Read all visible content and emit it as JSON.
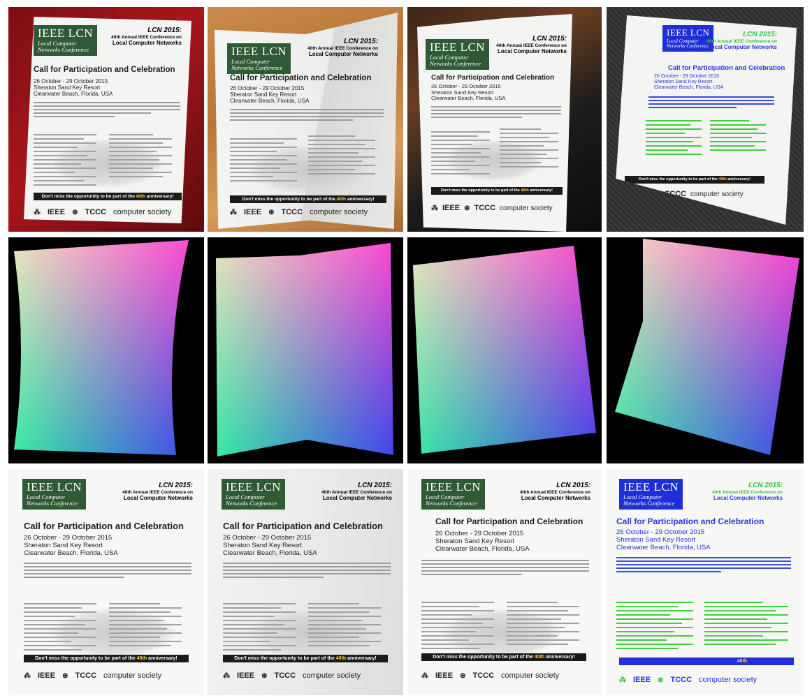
{
  "flyer": {
    "logo_main": "IEEE LCN",
    "logo_sub1": "Local Computer",
    "logo_sub2": "Networks Conference",
    "conf_title": "LCN 2015:",
    "conf_line2": "40th Annual IEEE Conference on",
    "conf_line3": "Local Computer Networks",
    "headline": "Call for Participation and Celebration",
    "dates": "26 October - 29 October 2015",
    "venue": "Sheraton Sand Key Resort",
    "location": "Clearwater Beach, Florida, USA",
    "banner_prefix": "Don't miss the opportunity to be part of the ",
    "banner_highlight": "40th",
    "banner_suffix": " anniversary!",
    "footer_ieee": "IEEE",
    "footer_tccc": "TCCC",
    "footer_cs": "computer society"
  },
  "flow_colors": {
    "top_left": "#f2e7c0",
    "top_right": "#ff3fd0",
    "bottom_left": "#31f0a0",
    "bottom_right": "#3a3ff0"
  },
  "background_colors": {
    "red_cloth": "#9a1418",
    "wood_table": "#c1803f",
    "dark_desk": "#1c1c1c",
    "carpet": "#333333",
    "mask": "#000000"
  },
  "tint_colors": {
    "blue": "#2a36e0",
    "green": "#2ec23a"
  }
}
